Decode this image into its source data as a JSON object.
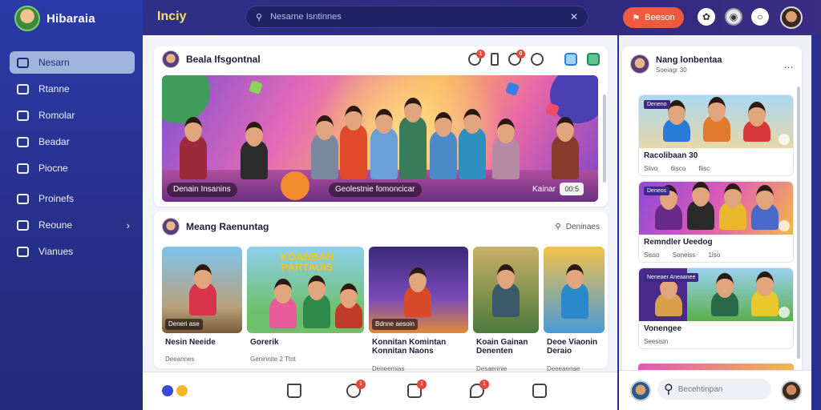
{
  "sidebar": {
    "brand": "Hibaraia",
    "items": [
      {
        "label": "Nesarn",
        "icon": "home-icon",
        "active": true
      },
      {
        "label": "Rtanne",
        "icon": "video-icon"
      },
      {
        "label": "Romolar",
        "icon": "check-icon"
      },
      {
        "label": "Beadar",
        "icon": "bookmark-icon"
      },
      {
        "label": "Piocne",
        "icon": "pin-icon"
      },
      {
        "label": "Proinefs",
        "icon": "folder-icon"
      },
      {
        "label": "Reoune",
        "icon": "user-icon",
        "chevron": "›"
      },
      {
        "label": "Vianues",
        "icon": "settings-icon"
      }
    ]
  },
  "topbar": {
    "app_title": "Inciy",
    "search_placeholder": "Nesarne Isntinnes",
    "cta_label": "Beeson",
    "icons": [
      "paw-icon",
      "camera-icon",
      "chat-icon",
      "user-avatar"
    ]
  },
  "feed": {
    "author": "Beala Ifsgontnal",
    "badges": [
      "1",
      "0"
    ],
    "hero_captions": [
      "Denain Insanins",
      "Geolestnie fomoncicar",
      "Kainar",
      "00:5"
    ]
  },
  "strip": {
    "title": "Meang Raenuntag",
    "search_label": "Deninaes",
    "tiles": [
      {
        "tag": "Deneri ase",
        "title": "Nesin Neeide",
        "meta": "Deeannes"
      },
      {
        "tag": "",
        "title": "Gorerik",
        "meta": "Geninnite   2 Ttnt",
        "overlay": "KOANBAN PARTAUIS"
      },
      {
        "tag": "Bdnne aesoin",
        "title": "Konnitan Komintan Konnitan Naons",
        "meta": "Deneemias"
      },
      {
        "tag": "",
        "title": "Koain Gainan Denenten",
        "meta": "Desaerinie"
      },
      {
        "tag": "",
        "title": "Deoe Viaonin Deraio",
        "meta": "Deeeaenae"
      }
    ]
  },
  "bottombar": {
    "badges": [
      "1",
      "1",
      "1"
    ]
  },
  "side": {
    "title": "Nang lonbentaa",
    "subtitle": "Soeiagr 30",
    "more": "…",
    "items": [
      {
        "badge": "Deneno",
        "title": "Racolibaan 30",
        "meta": "Siivo 6isco fiisc"
      },
      {
        "badge": "Deneos",
        "title": "Remndler Ueedog",
        "meta": "Sisso Soneiss 1iso"
      },
      {
        "badge": "Neneaer Aneaanee",
        "title": "Vonengee",
        "meta": "Seesisin"
      }
    ],
    "comment_placeholder": "Becehtinpan"
  }
}
